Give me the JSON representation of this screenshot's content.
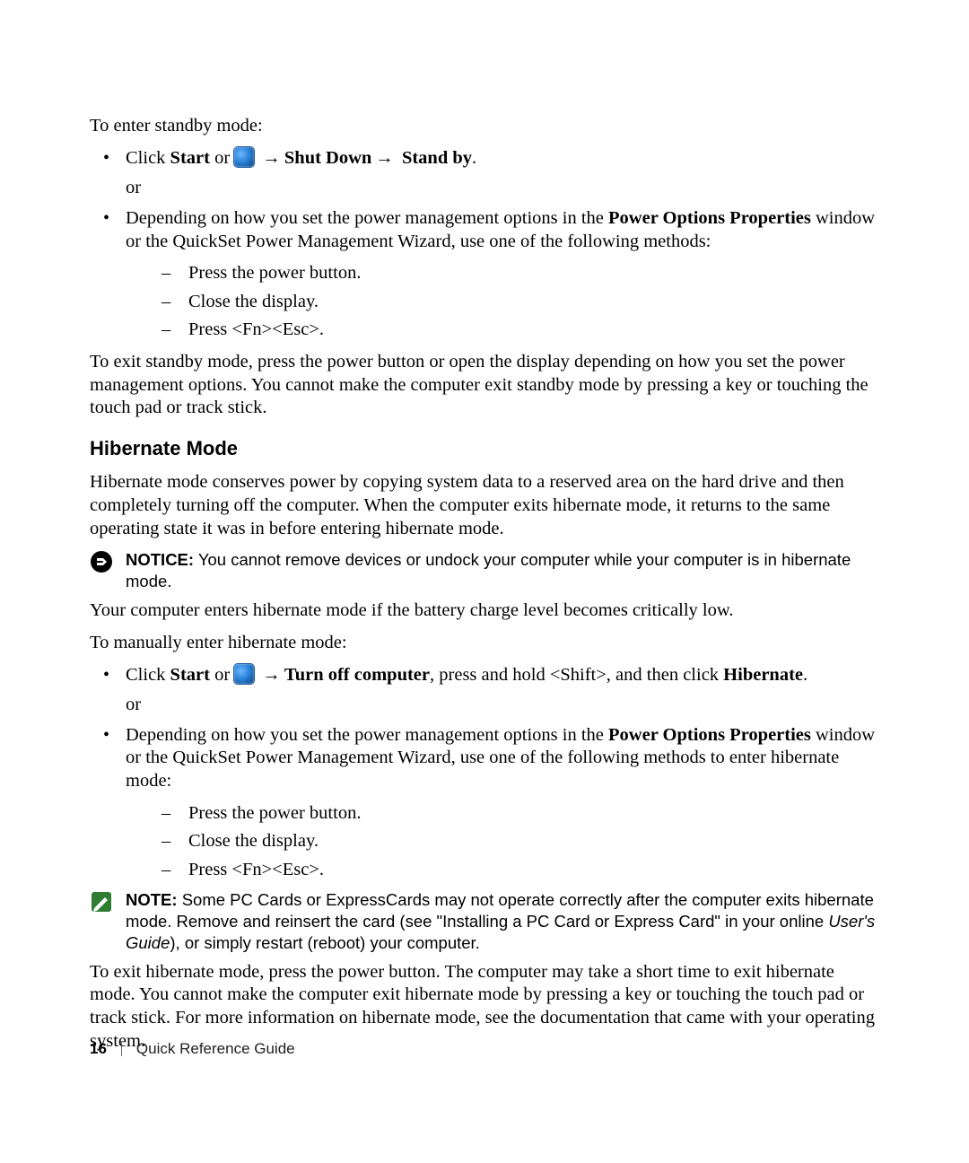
{
  "intro": {
    "enter_standby": "To enter standby mode:"
  },
  "standby": {
    "click_prefix": "Click ",
    "start": "Start",
    "or_word": " or ",
    "arrow": "→",
    "shut_down": "Shut Down",
    "stand_by": "Stand by",
    "period": ".",
    "or": "or",
    "depending_pre": "Depending on how you set the power management options in the ",
    "pop": "Power Options Properties",
    "depending_post": " window or the QuickSet Power Management Wizard, use one of the following methods:",
    "m1": "Press the power button.",
    "m2": "Close the display.",
    "m3": "Press <Fn><Esc>.",
    "exit": "To exit standby mode, press the power button or open the display depending on how you set the power management options. You cannot make the computer exit standby mode by pressing a key or touching the touch pad or track stick."
  },
  "hibernate": {
    "heading": "Hibernate Mode",
    "intro": "Hibernate mode conserves power by copying system data to a reserved area on the hard drive and then completely turning off the computer. When the computer exits hibernate mode, it returns to the same operating state it was in before entering hibernate mode.",
    "notice_label": "NOTICE:",
    "notice_text": " You cannot remove devices or undock your computer while your computer is in hibernate mode.",
    "auto": "Your computer enters hibernate mode if the battery charge level becomes critically low.",
    "manual": "To manually enter hibernate mode:",
    "click_prefix": "Click ",
    "start": "Start",
    "or_word": " or ",
    "arrow": "→",
    "turn_off": "Turn off computer",
    "mid": ", press and hold <Shift>, and then click ",
    "hib_word": "Hibernate",
    "period": ".",
    "or": "or",
    "depending_pre": "Depending on how you set the power management options in the ",
    "pop": "Power Options Properties",
    "depending_post": " window or the QuickSet Power Management Wizard, use one of the following methods to enter hibernate mode:",
    "m1": "Press the power button.",
    "m2": "Close the display.",
    "m3": "Press <Fn><Esc>.",
    "note_label": "NOTE:",
    "note_pre": " Some PC Cards or ExpressCards may not operate correctly after the computer exits hibernate mode. Remove and reinsert the card (see \"Installing a PC Card or Express Card\" in your online ",
    "note_italic": "User's Guide",
    "note_post": "), or simply restart (reboot) your computer.",
    "exit": "To exit hibernate mode, press the power button. The computer may take a short time to exit hibernate mode. You cannot make the computer exit hibernate mode by pressing a key or touching the touch pad or track stick. For more information on hibernate mode, see the documentation that came with your operating system."
  },
  "footer": {
    "page": "16",
    "title": "Quick Reference Guide"
  }
}
